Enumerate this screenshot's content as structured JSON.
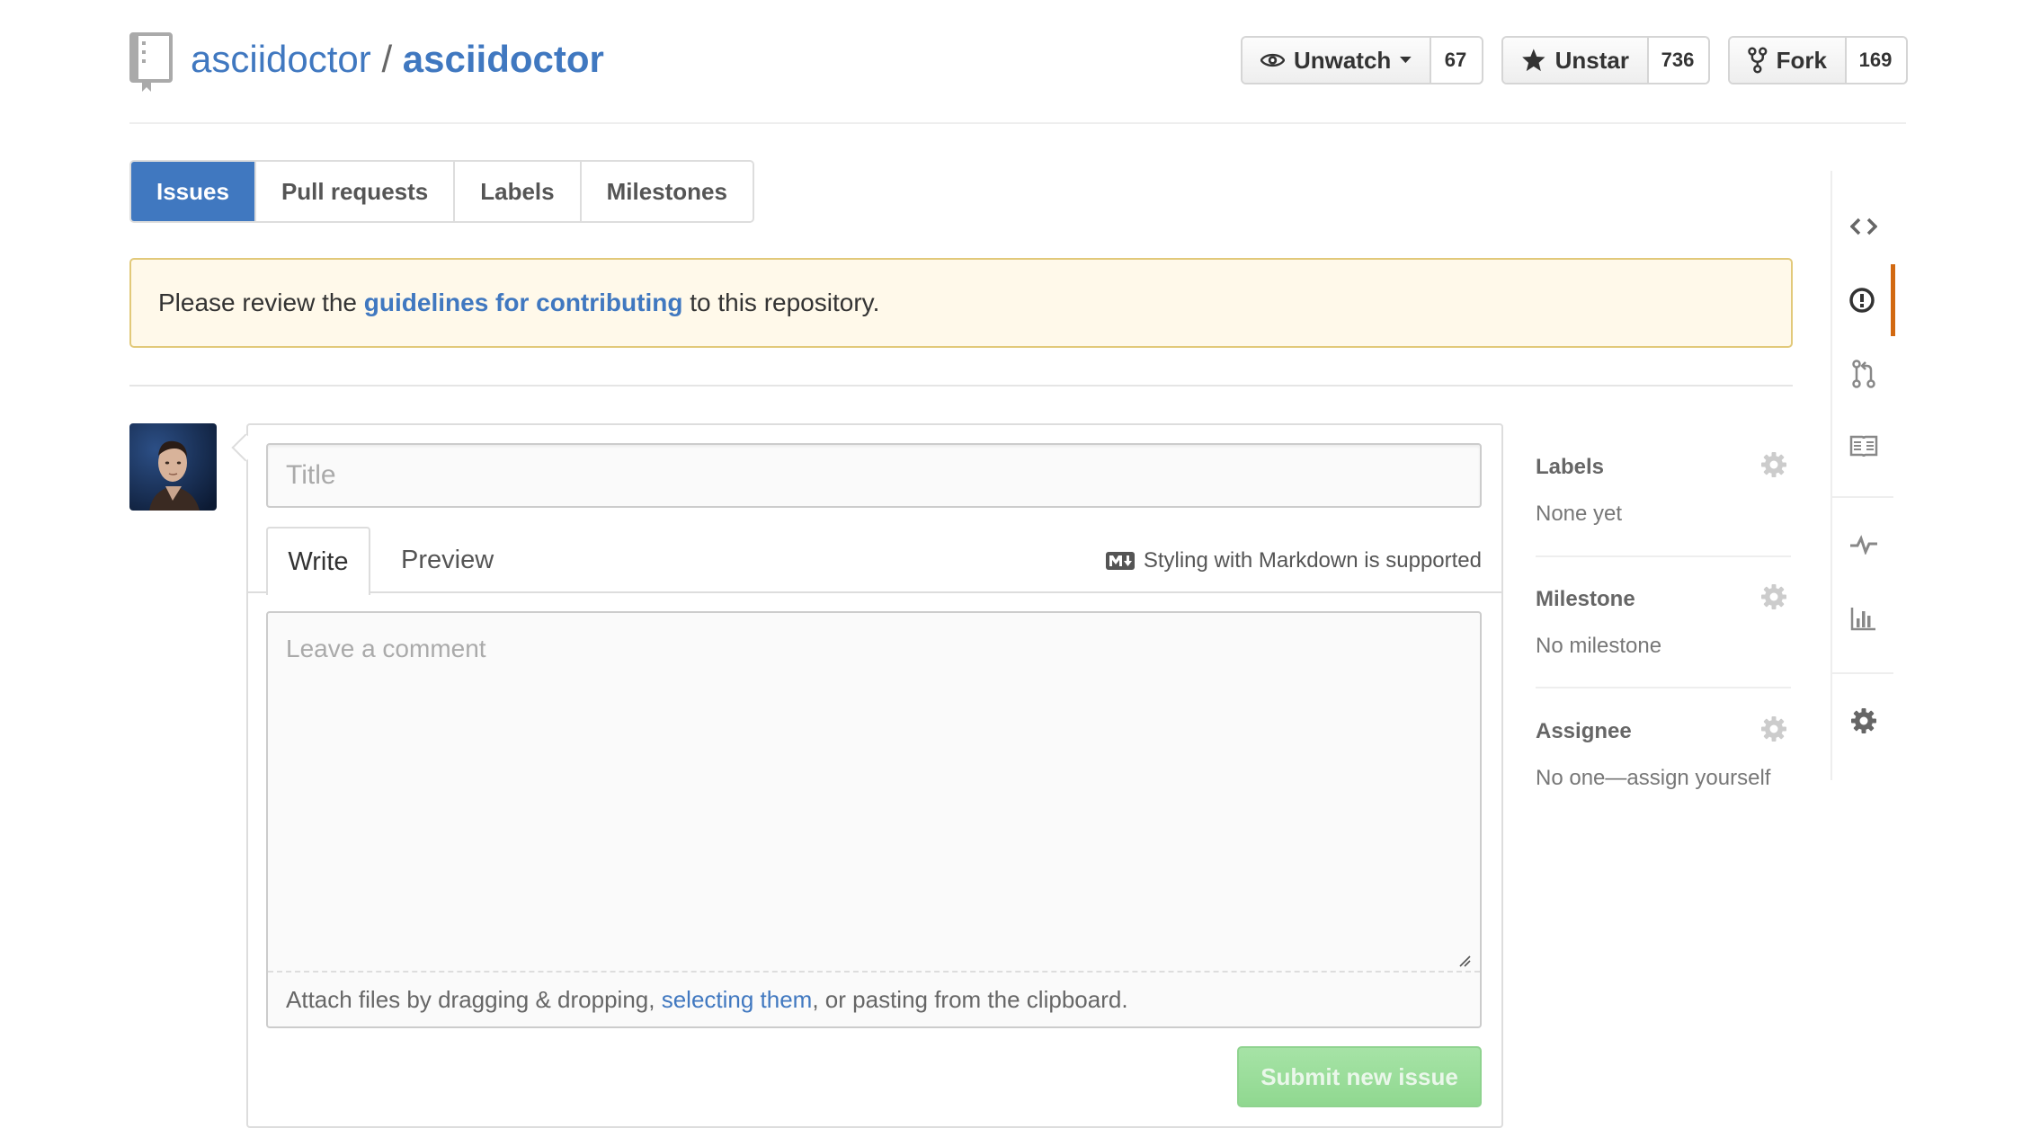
{
  "repo": {
    "owner": "asciidoctor",
    "separator": "/",
    "name": "asciidoctor"
  },
  "actions": [
    {
      "id": "watch",
      "label": "Unwatch",
      "count": "67",
      "icon": "eye-icon",
      "dropdown": true
    },
    {
      "id": "star",
      "label": "Unstar",
      "count": "736",
      "icon": "star-icon"
    },
    {
      "id": "fork",
      "label": "Fork",
      "count": "169",
      "icon": "fork-icon"
    }
  ],
  "subnav": {
    "selected": "Issues",
    "items": [
      "Issues",
      "Pull requests",
      "Labels",
      "Milestones"
    ]
  },
  "flash": {
    "prefix": "Please review the ",
    "link": "guidelines for contributing",
    "suffix": " to this repository."
  },
  "form": {
    "title_placeholder": "Title",
    "tabs": {
      "write": "Write",
      "preview": "Preview"
    },
    "markdown_note": "Styling with Markdown is supported",
    "comment_placeholder": "Leave a comment",
    "attach": {
      "prefix": "Attach files by dragging & dropping, ",
      "link": "selecting them",
      "suffix": ", or pasting from the clipboard."
    },
    "submit_label": "Submit new issue"
  },
  "sidebar": {
    "labels": {
      "heading": "Labels",
      "value": "None yet"
    },
    "milestone": {
      "heading": "Milestone",
      "value": "No milestone"
    },
    "assignee": {
      "heading": "Assignee",
      "value": "No one—assign yourself"
    }
  },
  "repo_nav": {
    "active": "issues",
    "items": [
      "code-icon",
      "issues-icon",
      "pull-request-icon",
      "wiki-icon",
      "pulse-icon",
      "graphs-icon",
      "settings-icon"
    ]
  },
  "colors": {
    "link": "#4078c0",
    "selected_tab": "#4078c0",
    "flash_bg": "#fff9ea",
    "flash_border": "#e2c97a",
    "submit_disabled": "#a6e3a6",
    "nav_active": "#d26911"
  }
}
